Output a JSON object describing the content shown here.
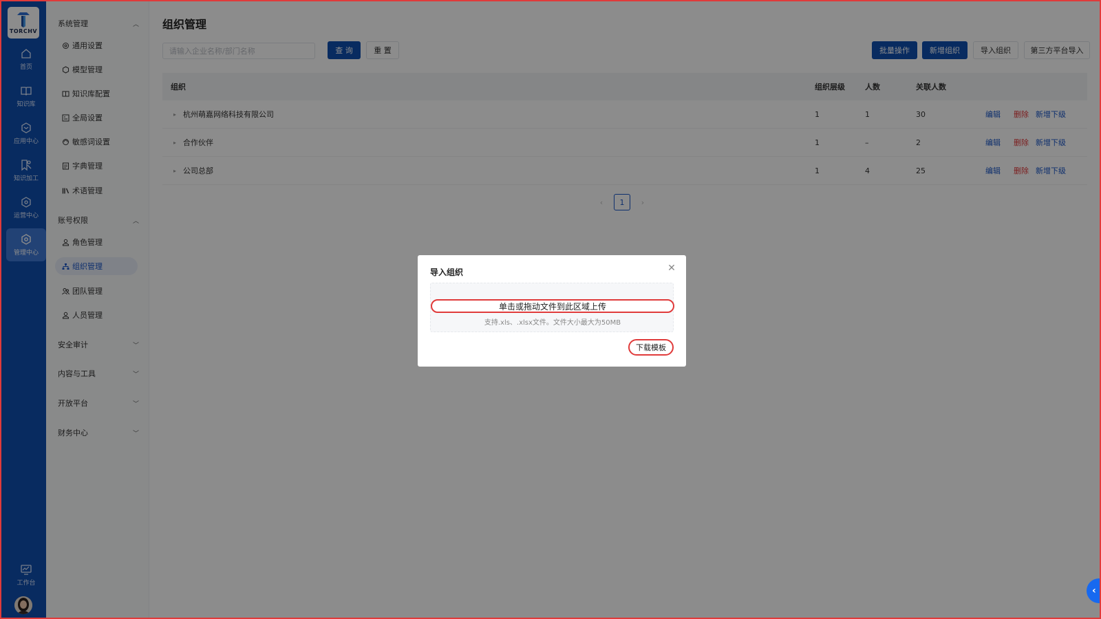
{
  "brand": {
    "logo_text": "TORCHV"
  },
  "rail": {
    "items": [
      {
        "label": "首页",
        "icon": "home-icon"
      },
      {
        "label": "知识库",
        "icon": "book-icon"
      },
      {
        "label": "应用中心",
        "icon": "cube-icon"
      },
      {
        "label": "知识加工",
        "icon": "edit-doc-icon"
      },
      {
        "label": "运营中心",
        "icon": "operations-icon"
      },
      {
        "label": "管理中心",
        "icon": "settings-icon"
      }
    ],
    "workbench_label": "工作台"
  },
  "sidebar": {
    "groups": [
      {
        "label": "系统管理",
        "expanded": true
      },
      {
        "label": "账号权限",
        "expanded": true
      },
      {
        "label": "安全审计",
        "expanded": false
      },
      {
        "label": "内容与工具",
        "expanded": false
      },
      {
        "label": "开放平台",
        "expanded": false
      },
      {
        "label": "财务中心",
        "expanded": false
      }
    ],
    "items": [
      {
        "label": "通用设置",
        "icon": "gear-icon"
      },
      {
        "label": "模型管理",
        "icon": "model-icon"
      },
      {
        "label": "知识库配置",
        "icon": "book-icon"
      },
      {
        "label": "全局设置",
        "icon": "grid-icon"
      },
      {
        "label": "敏感词设置",
        "icon": "filter-icon"
      },
      {
        "label": "字典管理",
        "icon": "dictionary-icon"
      },
      {
        "label": "术语管理",
        "icon": "library-icon"
      },
      {
        "label": "角色管理",
        "icon": "user-icon"
      },
      {
        "label": "组织管理",
        "icon": "org-tree-icon",
        "active": true
      },
      {
        "label": "团队管理",
        "icon": "team-icon"
      },
      {
        "label": "人员管理",
        "icon": "person-icon"
      }
    ]
  },
  "main": {
    "title": "组织管理",
    "search_placeholder": "请输入企业名称/部门名称",
    "query_label": "查 询",
    "reset_label": "重 置",
    "batch_label": "批量操作",
    "add_org_label": "新增组织",
    "import_org_label": "导入组织",
    "third_party_label": "第三方平台导入",
    "table": {
      "columns": [
        "组织",
        "组织层级",
        "人数",
        "关联人数"
      ],
      "rows": [
        {
          "name": "杭州萌嘉网络科技有限公司",
          "level": "1",
          "count": "1",
          "linked": "30"
        },
        {
          "name": "合作伙伴",
          "level": "1",
          "count": "–",
          "linked": "2"
        },
        {
          "name": "公司总部",
          "level": "1",
          "count": "4",
          "linked": "25"
        }
      ],
      "actions": {
        "edit": "编辑",
        "delete": "删除",
        "add_child": "新增下级"
      }
    },
    "pagination": {
      "current": "1"
    }
  },
  "modal": {
    "title": "导入组织",
    "upload_text": "单击或拖动文件到此区域上传",
    "upload_hint": "支持.xls、.xlsx文件。文件大小最大为50MB",
    "template_button": "下载模板"
  },
  "colors": {
    "brand_blue": "#0f4fb0",
    "danger_red": "#e1383a",
    "highlight_outline": "#e03a3a"
  }
}
